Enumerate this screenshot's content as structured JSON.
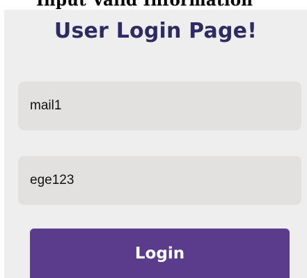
{
  "header": {
    "cut_text": "Input Valid Information"
  },
  "login": {
    "title": "User Login Page!",
    "email_value": "mail1",
    "password_value": "ege123",
    "button_label": "Login"
  },
  "colors": {
    "title": "#2f2a63",
    "panel_background": "#efeeee",
    "field_background": "#e3e0e0",
    "button_background": "#5a3b8c",
    "button_text": "#ffffff"
  }
}
